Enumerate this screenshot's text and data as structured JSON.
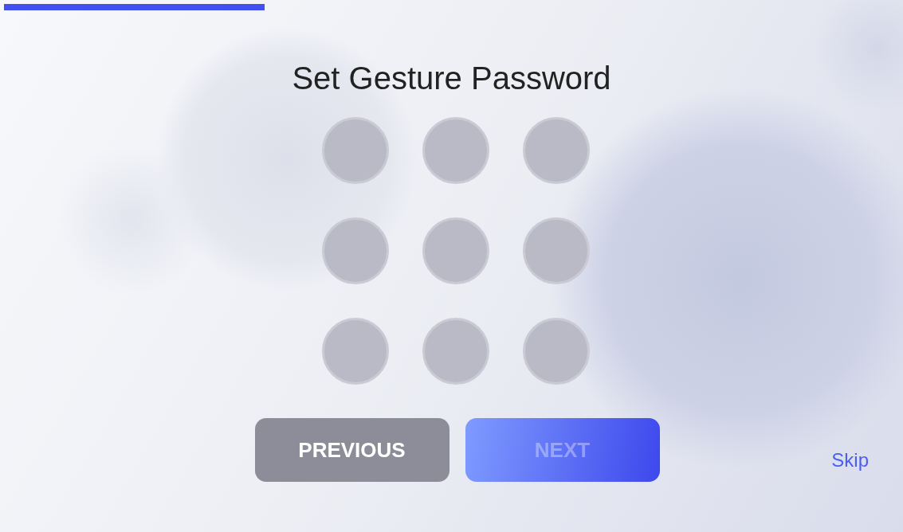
{
  "progress": {
    "level": 0.29
  },
  "title": "Set Gesture Password",
  "pattern": {
    "dots": [
      {
        "selected": false
      },
      {
        "selected": false
      },
      {
        "selected": false
      },
      {
        "selected": false
      },
      {
        "selected": false
      },
      {
        "selected": false
      },
      {
        "selected": false
      },
      {
        "selected": false
      },
      {
        "selected": false
      }
    ]
  },
  "buttons": [
    {
      "kind": "secondary",
      "label": "PREVIOUS",
      "disabled": false
    },
    {
      "kind": "primary",
      "label": "NEXT",
      "disabled": true
    }
  ],
  "skip": "Skip"
}
